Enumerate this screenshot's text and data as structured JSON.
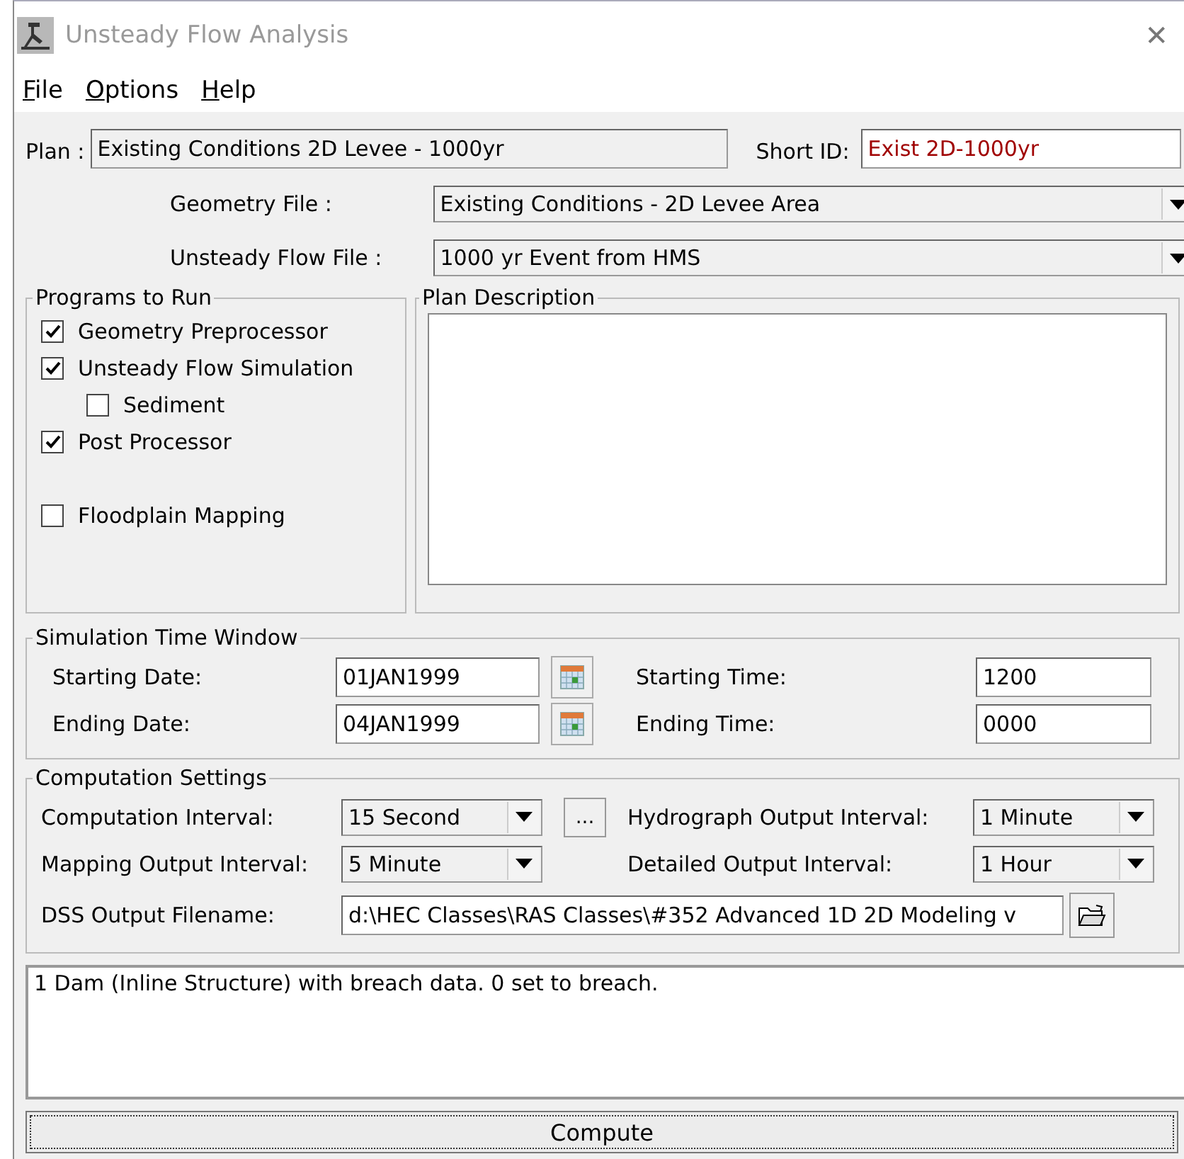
{
  "window": {
    "title": "Unsteady Flow Analysis",
    "close": "✕"
  },
  "menu": [
    {
      "label": "File"
    },
    {
      "label": "Options"
    },
    {
      "label": "Help"
    }
  ],
  "plan": {
    "label": "Plan :",
    "value": "Existing Conditions 2D Levee - 1000yr"
  },
  "short_id": {
    "label": "Short ID:",
    "value": "Exist 2D-1000yr"
  },
  "files": [
    {
      "label": "Geometry File :",
      "value": "Existing Conditions - 2D Levee Area"
    },
    {
      "label": "Unsteady Flow File :",
      "value": "1000 yr Event from HMS"
    }
  ],
  "programs": {
    "title": "Programs to Run",
    "items": [
      {
        "label": "Geometry Preprocessor",
        "checked": true
      },
      {
        "label": "Unsteady Flow Simulation",
        "checked": true,
        "children": [
          {
            "label": "Sediment",
            "checked": false
          }
        ]
      },
      {
        "label": "Post Processor",
        "checked": true
      }
    ],
    "mapping": {
      "label": "Floodplain Mapping",
      "checked": false
    }
  },
  "plan_description": {
    "title": "Plan Description"
  },
  "simulation_time_window": {
    "title": "Simulation Time Window",
    "rows": [
      {
        "date": {
          "label": "Starting Date:",
          "value": "01JAN1999"
        },
        "time": {
          "label": "Starting Time:",
          "value": "1200"
        }
      },
      {
        "date": {
          "label": "Ending Date:",
          "value": "04JAN1999"
        },
        "time": {
          "label": "Ending Time:",
          "value": "0000"
        }
      }
    ]
  },
  "computation_settings": {
    "title": "Computation Settings",
    "rows": [
      [
        {
          "label": "Computation Interval:",
          "value": "15 Second",
          "more": "..."
        },
        {
          "label": "Hydrograph Output Interval:",
          "value": "1 Minute"
        }
      ],
      [
        {
          "label": "Mapping Output Interval:",
          "value": "5 Minute"
        },
        {
          "label": "Detailed Output Interval:",
          "value": "1 Hour"
        }
      ]
    ],
    "dss": {
      "label": "DSS Output Filename:",
      "value": "d:\\HEC Classes\\RAS Classes\\#352 Advanced 1D 2D Modeling v"
    }
  },
  "message": "1 Dam (Inline Structure) with breach data. 0 set to breach.",
  "compute_button": "Compute"
}
